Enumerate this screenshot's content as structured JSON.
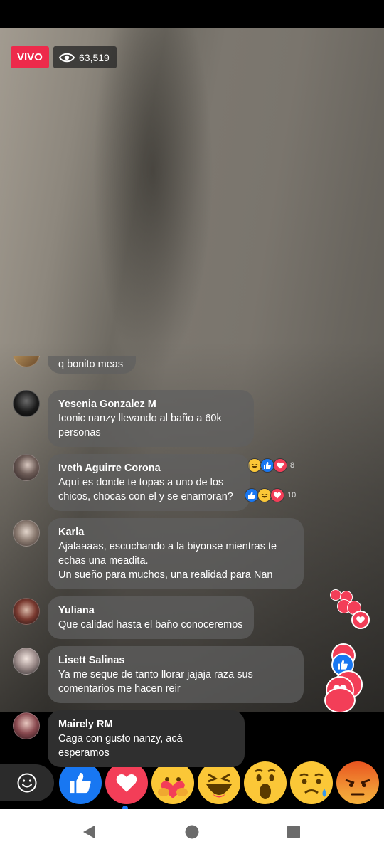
{
  "live": {
    "badge": "VIVO",
    "viewers": "63,519"
  },
  "comments": [
    {
      "name": "",
      "text": "q bonito meas"
    },
    {
      "name": "Yesenia Gonzalez M",
      "text": "Iconic nanzy llevando al baño a 60k\npersonas",
      "reactions": [
        "haha",
        "like",
        "love"
      ],
      "count": "8"
    },
    {
      "name": "Iveth Aguirre Corona",
      "text": "Aquí es donde te topas a uno de los\nchicos, chocas con el y se enamoran?",
      "reactions": [
        "like",
        "haha",
        "love"
      ],
      "count": "10"
    },
    {
      "name": "Karla",
      "text": "Ajalaaaas, escuchando a la biyonse mientras te\nechas una meadita.\nUn sueño para muchos, una realidad para Nan"
    },
    {
      "name": "Yuliana",
      "text": "Que calidad hasta el baño conoceremos"
    },
    {
      "name": "Lisett Salinas",
      "text": "Ya me seque de tanto llorar jajaja raza sus\ncomentarios me hacen reir"
    },
    {
      "name": "Mairely RM",
      "text": "Caga con gusto nanzy, acá esperamos"
    }
  ],
  "reaction_bar": {
    "items": [
      "like",
      "love",
      "care",
      "haha",
      "wow",
      "sad",
      "angry"
    ],
    "selected": "love"
  },
  "colors": {
    "live_red": "#ed2a4b",
    "like_blue": "#1877f2",
    "love_red": "#f33e58",
    "emoji_yellow": "#fbc737"
  },
  "icons": {
    "viewers": "eye-icon",
    "emoji": "smiley-icon",
    "back": "back-triangle-icon",
    "home": "home-circle-icon",
    "recents": "recents-square-icon"
  }
}
